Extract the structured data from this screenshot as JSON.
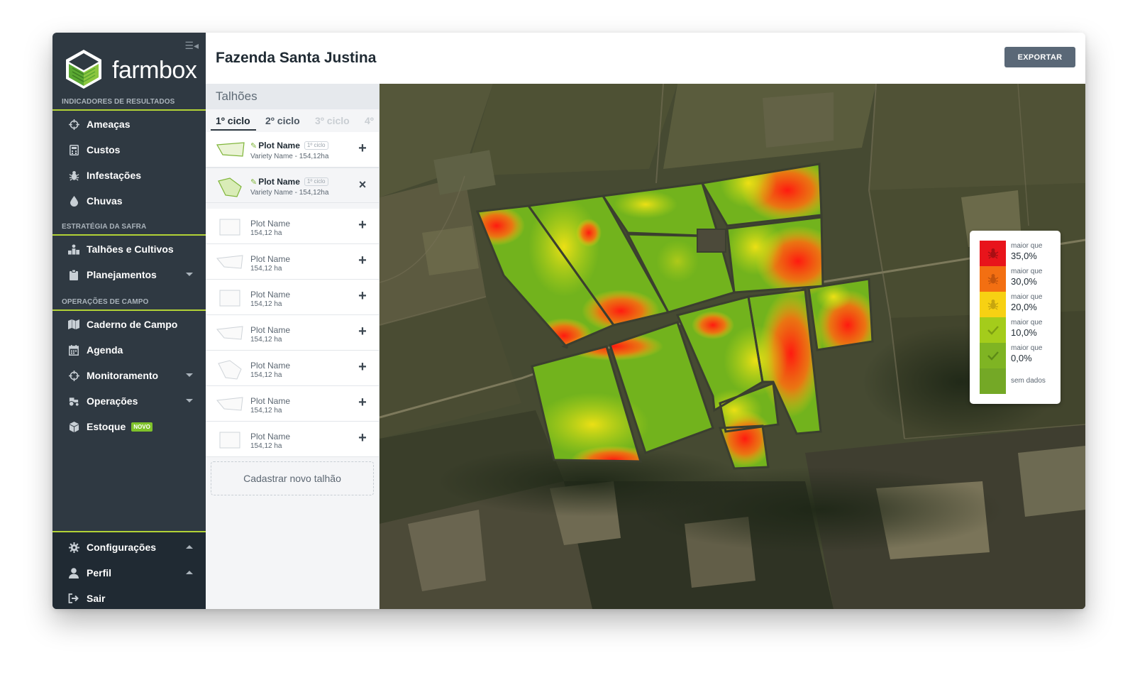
{
  "app": {
    "brand": "farmbox"
  },
  "sidebar": {
    "sections": [
      {
        "title": "INDICADORES DE RESULTADOS"
      },
      {
        "title": "ESTRATÉGIA DA SAFRA"
      },
      {
        "title": "OPERAÇÕES DE CAMPO"
      }
    ],
    "items": [
      {
        "label": "Ameaças",
        "icon": "crosshair-icon"
      },
      {
        "label": "Custos",
        "icon": "calculator-icon"
      },
      {
        "label": "Infestações",
        "icon": "bug-icon"
      },
      {
        "label": "Chuvas",
        "icon": "raindrop-icon"
      },
      {
        "label": "Talhões e Cultivos",
        "icon": "field-icon"
      },
      {
        "label": "Planejamentos",
        "icon": "clipboard-icon"
      },
      {
        "label": "Caderno de Campo",
        "icon": "map-book-icon"
      },
      {
        "label": "Agenda",
        "icon": "calendar-icon"
      },
      {
        "label": "Monitoramento",
        "icon": "crosshair-icon"
      },
      {
        "label": "Operações",
        "icon": "tractor-icon"
      },
      {
        "label": "Estoque",
        "icon": "box-icon",
        "badge": "NOVO"
      }
    ],
    "bottom": [
      {
        "label": "Configurações",
        "icon": "gear-icon"
      },
      {
        "label": "Perfil",
        "icon": "user-icon"
      },
      {
        "label": "Sair",
        "icon": "logout-icon"
      }
    ]
  },
  "header": {
    "title": "Fazenda Santa Justina",
    "export_label": "EXPORTAR"
  },
  "panel": {
    "title": "Talhões",
    "tabs": [
      "1º ciclo",
      "2º ciclo",
      "3º ciclo",
      "4º"
    ],
    "plots": [
      {
        "name": "Plot Name",
        "tag": "1º ciclo",
        "sub": "Variety Name - 154,12ha",
        "action": "+"
      },
      {
        "name": "Plot Name",
        "tag": "1º ciclo",
        "sub": "Variety Name - 154,12ha",
        "action": "×"
      },
      {
        "name": "Plot Name",
        "sub": "154,12 ha",
        "action": "+"
      },
      {
        "name": "Plot Name",
        "sub": "154,12 ha",
        "action": "+"
      },
      {
        "name": "Plot Name",
        "sub": "154,12 ha",
        "action": "+"
      },
      {
        "name": "Plot Name",
        "sub": "154,12 ha",
        "action": "+"
      },
      {
        "name": "Plot Name",
        "sub": "154,12 ha",
        "action": "+"
      },
      {
        "name": "Plot Name",
        "sub": "154,12 ha",
        "action": "+"
      },
      {
        "name": "Plot Name",
        "sub": "154,12 ha",
        "action": "+"
      }
    ],
    "add_label": "Cadastrar novo talhão"
  },
  "legend": {
    "items": [
      {
        "prefix": "maior que",
        "value": "35,0%",
        "color": "#e8141b",
        "icon": "bug-icon"
      },
      {
        "prefix": "maior que",
        "value": "30,0%",
        "color": "#f36f12",
        "icon": "bug-icon"
      },
      {
        "prefix": "maior que",
        "value": "20,0%",
        "color": "#f7d113",
        "icon": "bug-icon"
      },
      {
        "prefix": "maior que",
        "value": "10,0%",
        "color": "#a4cc1b",
        "icon": "check-icon"
      },
      {
        "prefix": "maior que",
        "value": "0,0%",
        "color": "#7fb423",
        "icon": "check-icon"
      },
      {
        "prefix": "",
        "value": "sem dados",
        "color": "#74a826",
        "icon": ""
      }
    ]
  }
}
